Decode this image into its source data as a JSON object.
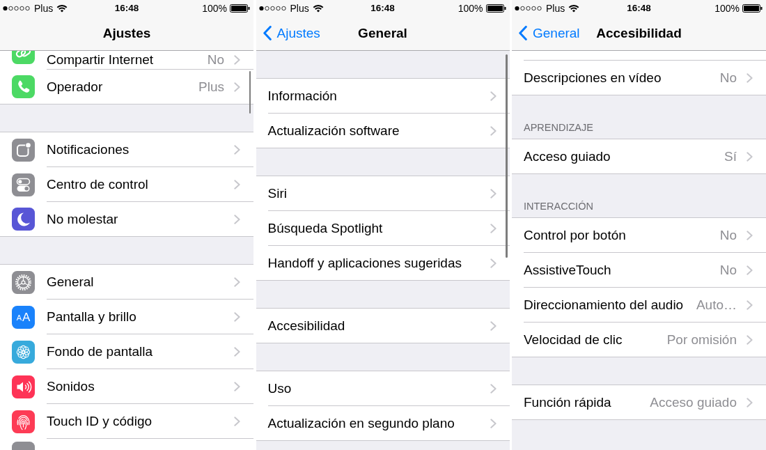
{
  "screens": [
    {
      "status_bar": {
        "carrier": "Plus",
        "time": "16:48",
        "battery": "100%"
      },
      "nav_bar": {
        "title": "Ajustes"
      },
      "groups": [
        {
          "rows": [
            {
              "label": "Compartir Internet",
              "value": "No"
            },
            {
              "label": "Operador",
              "value": "Plus"
            }
          ]
        },
        {
          "rows": [
            {
              "label": "Notificaciones"
            },
            {
              "label": "Centro de control"
            },
            {
              "label": "No molestar"
            }
          ]
        },
        {
          "cut_bottom": true,
          "rows": [
            {
              "label": "General"
            },
            {
              "label": "Pantalla y brillo",
              "icon_text": "AA"
            },
            {
              "label": "Fondo de pantalla"
            },
            {
              "label": "Sonidos"
            },
            {
              "label": "Touch ID y código"
            }
          ]
        }
      ]
    },
    {
      "status_bar": {
        "carrier": "Plus",
        "time": "16:48",
        "battery": "100%"
      },
      "nav_bar": {
        "back": "Ajustes",
        "title": "General"
      },
      "groups": [
        {
          "rows": [
            {
              "label": "Información"
            },
            {
              "label": "Actualización software"
            }
          ]
        },
        {
          "rows": [
            {
              "label": "Siri"
            },
            {
              "label": "Búsqueda Spotlight"
            },
            {
              "label": "Handoff y aplicaciones sugeridas"
            }
          ]
        },
        {
          "rows": [
            {
              "label": "Accesibilidad"
            }
          ]
        },
        {
          "rows": [
            {
              "label": "Uso"
            },
            {
              "label": "Actualización en segundo plano"
            }
          ]
        }
      ]
    },
    {
      "status_bar": {
        "carrier": "Plus",
        "time": "16:48",
        "battery": "100%"
      },
      "nav_bar": {
        "back": "General",
        "title": "Accesibilidad"
      },
      "groups": [
        {
          "cut_top": true,
          "rows": [
            {
              "label": "Descripciones en vídeo",
              "value": "No"
            }
          ]
        },
        {
          "header": "APRENDIZAJE",
          "rows": [
            {
              "label": "Acceso guiado",
              "value": "Sí"
            }
          ]
        },
        {
          "header": "INTERACCIÓN",
          "rows": [
            {
              "label": "Control por botón",
              "value": "No"
            },
            {
              "label": "AssistiveTouch",
              "value": "No"
            },
            {
              "label": "Direccionamiento del audio",
              "value": "Auto…"
            },
            {
              "label": "Velocidad de clic",
              "value": "Por omisión"
            }
          ]
        },
        {
          "rows": [
            {
              "label": "Función rápida",
              "value": "Acceso guiado"
            }
          ]
        }
      ]
    }
  ]
}
